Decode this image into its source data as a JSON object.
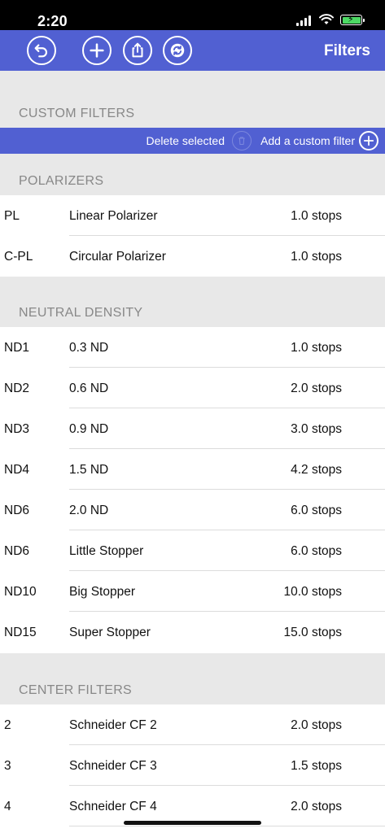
{
  "status_bar": {
    "time": "2:20"
  },
  "nav": {
    "title": "Filters",
    "buttons": [
      "back-icon",
      "add-icon",
      "share-icon",
      "sync-icon"
    ]
  },
  "custom_filters": {
    "header": "CUSTOM FILTERS",
    "delete_label": "Delete selected",
    "add_label": "Add a custom filter"
  },
  "sections": [
    {
      "header": "POLARIZERS",
      "rows": [
        {
          "code": "PL",
          "name": "Linear Polarizer",
          "stops": "1.0 stops"
        },
        {
          "code": "C-PL",
          "name": "Circular Polarizer",
          "stops": "1.0 stops"
        }
      ]
    },
    {
      "header": "NEUTRAL DENSITY",
      "rows": [
        {
          "code": "ND1",
          "name": "0.3 ND",
          "stops": "1.0 stops"
        },
        {
          "code": "ND2",
          "name": "0.6 ND",
          "stops": "2.0 stops"
        },
        {
          "code": "ND3",
          "name": "0.9 ND",
          "stops": "3.0 stops"
        },
        {
          "code": "ND4",
          "name": "1.5 ND",
          "stops": "4.2 stops"
        },
        {
          "code": "ND6",
          "name": "2.0 ND",
          "stops": "6.0 stops"
        },
        {
          "code": "ND6",
          "name": "Little Stopper",
          "stops": "6.0 stops"
        },
        {
          "code": "ND10",
          "name": "Big Stopper",
          "stops": "10.0 stops"
        },
        {
          "code": "ND15",
          "name": "Super Stopper",
          "stops": "15.0 stops"
        }
      ]
    },
    {
      "header": "CENTER FILTERS",
      "rows": [
        {
          "code": "2",
          "name": "Schneider CF 2",
          "stops": "2.0 stops"
        },
        {
          "code": "3",
          "name": "Schneider CF 3",
          "stops": "1.5 stops"
        },
        {
          "code": "4",
          "name": "Schneider CF 4",
          "stops": "2.0 stops"
        }
      ]
    }
  ],
  "colors": {
    "accent": "#5160d2",
    "section_bg": "#e8e8e8",
    "section_text": "#888888"
  }
}
